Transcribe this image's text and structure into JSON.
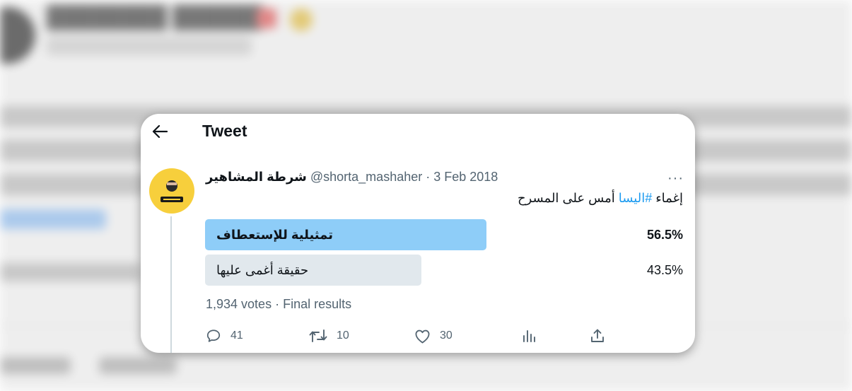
{
  "header": {
    "title": "Tweet"
  },
  "tweet": {
    "author_name": "شرطة المشاهير",
    "handle": "@shorta_mashaher",
    "separator": "·",
    "date": "3 Feb 2018",
    "more_label": "···",
    "text_prefix": "إغماء ",
    "hashtag": "#اليسا",
    "text_suffix": " أمس على المسرح"
  },
  "poll": {
    "options": [
      {
        "label": "تمثيلية للإستعطاف",
        "percent_label": "56.5%",
        "percent": 56.5,
        "winner": true
      },
      {
        "label": "حقيقة أغمى عليها",
        "percent_label": "43.5%",
        "percent": 43.5,
        "winner": false
      }
    ],
    "votes": "1,934 votes",
    "separator": "·",
    "status": "Final results"
  },
  "actions": {
    "reply_count": "41",
    "retweet_count": "10",
    "like_count": "30"
  },
  "colors": {
    "accent": "#1d9bf0",
    "winner_bar": "#8ecdf8",
    "loser_bar": "#e1e8ed",
    "avatar_bg": "#f7cf3c"
  },
  "icons": [
    "back-arrow-icon",
    "reply-icon",
    "retweet-icon",
    "like-icon",
    "analytics-icon",
    "share-icon"
  ]
}
